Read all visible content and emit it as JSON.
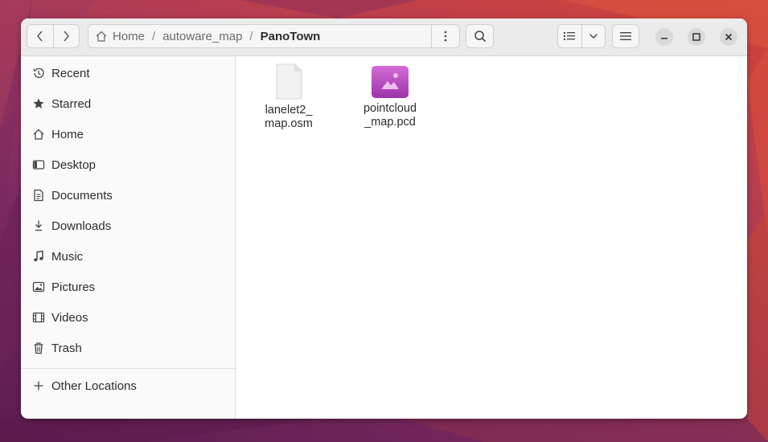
{
  "colors": {
    "accent": "#c04bc0",
    "pcd_icon_top": "#cf63d0",
    "pcd_icon_bottom": "#9a34a8"
  },
  "nav": {
    "back_icon": "chevron-left-icon",
    "forward_icon": "chevron-right-icon"
  },
  "pathbar": {
    "crumbs": [
      "Home",
      "autoware_map",
      "PanoTown"
    ],
    "separator": "/"
  },
  "sidebar": {
    "items": [
      {
        "label": "Recent",
        "icon": "clock-icon"
      },
      {
        "label": "Starred",
        "icon": "star-icon"
      },
      {
        "label": "Home",
        "icon": "home-icon"
      },
      {
        "label": "Desktop",
        "icon": "desktop-icon"
      },
      {
        "label": "Documents",
        "icon": "document-icon"
      },
      {
        "label": "Downloads",
        "icon": "download-icon"
      },
      {
        "label": "Music",
        "icon": "music-icon"
      },
      {
        "label": "Pictures",
        "icon": "picture-icon"
      },
      {
        "label": "Videos",
        "icon": "film-icon"
      },
      {
        "label": "Trash",
        "icon": "trash-icon"
      }
    ],
    "other": {
      "label": "Other Locations",
      "icon": "plus-icon"
    }
  },
  "files": [
    {
      "name": "lanelet2_\nmap.osm",
      "type": "generic-file-icon"
    },
    {
      "name": "pointcloud\n_map.pcd",
      "type": "image-file-icon"
    }
  ]
}
